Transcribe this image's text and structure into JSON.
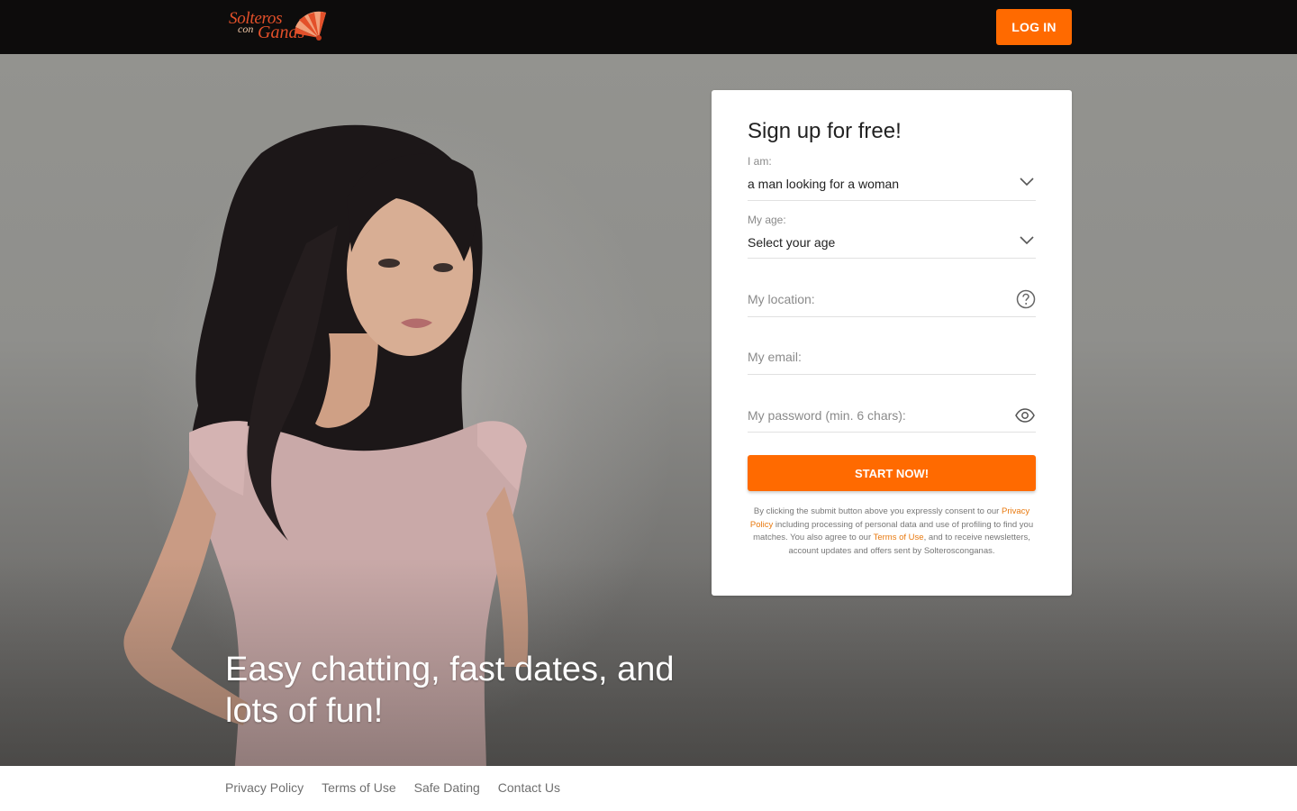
{
  "header": {
    "logo": {
      "line1": "Solteros",
      "line2": "con",
      "line3": "Ganas"
    },
    "login_label": "LOG IN"
  },
  "hero": {
    "tagline": "Easy chatting, fast dates, and lots of fun!"
  },
  "signup": {
    "title": "Sign up for free!",
    "iam": {
      "label": "I am:",
      "value": "a man looking for a woman",
      "icon": "chevron-down-icon"
    },
    "age": {
      "label": "My age:",
      "value": "Select your age",
      "icon": "chevron-down-icon"
    },
    "location": {
      "placeholder": "My location:",
      "icon": "help-circle-icon"
    },
    "email": {
      "placeholder": "My email:"
    },
    "password": {
      "placeholder": "My password (min. 6 chars):",
      "icon": "eye-icon"
    },
    "submit_label": "START NOW!",
    "legal": {
      "part1": "By clicking the submit button above you expressly consent to our ",
      "privacy_link": "Privacy Policy",
      "part2": " including processing of personal data and use of profiling to find you matches. You also agree to our ",
      "terms_link": "Terms of Use",
      "part3": ", and to receive newsletters, account updates and offers sent by Solterosconganas."
    }
  },
  "footer": {
    "links": [
      "Privacy Policy",
      "Terms of Use",
      "Safe Dating",
      "Contact Us"
    ]
  },
  "colors": {
    "accent": "#ff6a00",
    "header_bg": "#0d0c0c",
    "link": "#e8790f"
  }
}
